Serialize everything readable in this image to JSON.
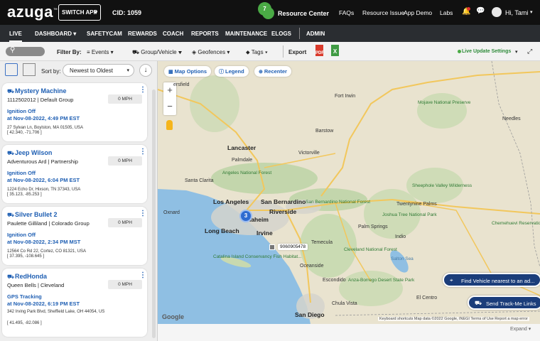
{
  "topbar": {
    "logo": "azuga",
    "logo_mark": "™",
    "switch_app": "SWITCH APP",
    "cid": "CID: 1059",
    "resource_badge": "7",
    "resource_center": "Resource Center",
    "links": [
      "FAQs",
      "Resource Issue",
      "App Demo",
      "Labs"
    ],
    "user": "Hi, Tami"
  },
  "nav": {
    "items": [
      "LIVE",
      "DASHBOARD",
      "SAFETYCAM",
      "REWARDS",
      "COACH",
      "REPORTS",
      "MAINTENANCE",
      "ELOGS",
      "ADMIN"
    ],
    "active": "LIVE"
  },
  "filters": {
    "filter_by": "Filter By:",
    "events": "Events",
    "group_vehicle": "Group/Vehicle",
    "geofences": "Geofences",
    "tags": "Tags",
    "export": "Export",
    "pdf": "PDF",
    "xls": "X",
    "live_update": "Live Update Settings"
  },
  "sidebar": {
    "sort_by": "Sort by:",
    "sort_value": "Newest to Oldest",
    "vehicles": [
      {
        "name": "Mystery Machine",
        "group": "1112502012 | Default Group",
        "speed": "0 MPH",
        "status": "Ignition Off",
        "time": "at Nov-08-2022, 4:49 PM EST",
        "address": "27 Sylvan Ln, Boylston, MA 01505, USA",
        "coords": "[ 42.340, -71.706 ]"
      },
      {
        "name": "Jeep Wilson",
        "group": "Adventurous Ard | Partnership",
        "speed": "0 MPH",
        "status": "Ignition Off",
        "time": "at Nov-08-2022, 6:04 PM EST",
        "address": "1224 Echo Dr, Hixson, TN 37343, USA",
        "coords": "[ 35.123, -85.253 ]"
      },
      {
        "name": "Silver Bullet 2",
        "group": "Paulette Gilliland | Colorado Group",
        "speed": "0 MPH",
        "status": "Ignition Off",
        "time": "at Nov-08-2022, 2:34 PM MST",
        "address": "12564 Co Rd 22, Cortez, CO 81321, USA",
        "coords": "[ 37.395, -108.645 ]"
      },
      {
        "name": "RedHonda",
        "group": "Queen Bells | Cleveland",
        "speed": "0 MPH",
        "status": "GPS Tracking",
        "time": "at Nov-08-2022, 6:19 PM EST",
        "address": "342 Irving Park Blvd, Sheffield Lake, OH 44054, US",
        "coords": "[ 41.495, -82.086 ]"
      }
    ]
  },
  "map": {
    "map_options": "Map Options",
    "legend": "Legend",
    "recenter": "Recenter",
    "cluster_count": "3",
    "vehicle_tag": "9060905478",
    "find_vehicle": "Find Vehicle nearest to an ad...",
    "send_track": "Send Track-Me Links",
    "google": "Google",
    "attribution": "Keyboard shortcuts   Map data ©2022 Google, INEGI   Terms of Use   Report a map error",
    "expand": "Expand",
    "labels": {
      "bakersfield": "ersfield",
      "fort_irwin": "Fort Irwin",
      "mojave": "Mojave National Preserve",
      "needles": "Needles",
      "barstow": "Barstow",
      "victorville": "Victorville",
      "lancaster": "Lancaster",
      "palmdale": "Palmdale",
      "angeles": "Angeles National Forest",
      "los_angeles": "Los Angeles",
      "san_bernardino": "San Bernardino",
      "riverside": "Riverside",
      "long_beach": "Long Beach",
      "anaheim": "Anaheim",
      "irvine": "Irvine",
      "catalina": "Catalina Island Conservancy Fish Habitat...",
      "san_diego": "San Diego",
      "oceanside": "Oceanside",
      "escondido": "Escondido",
      "palm_springs": "Palm Springs",
      "indio": "Indio",
      "joshua_tree": "Joshua Tree National Park",
      "sheephole": "Sheephole Valley Wilderness",
      "salton": "Salton Sea",
      "anza": "Anza-Borrego Desert State Park",
      "chula_vista": "Chula Vista",
      "temecula": "Temecula",
      "el_centro": "El Centro",
      "cleveland_nf": "Cleveland National Forest",
      "sb_nf": "San Bernardino National Forest",
      "chemehuevi": "Chemehuevi Reservation",
      "twentynine": "Twentynine Palms",
      "santa_clarita": "Santa Clarita",
      "oxnard": "Oxnard"
    }
  }
}
